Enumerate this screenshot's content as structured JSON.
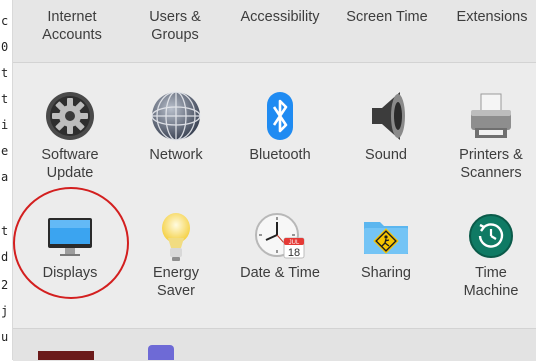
{
  "left_strip_chars": [
    "c",
    "0",
    "t",
    "t",
    "i",
    "e",
    "a",
    "t",
    "d",
    "2",
    "j",
    "u"
  ],
  "top_row": [
    {
      "label": "Internet\nAccounts"
    },
    {
      "label": "Users &\nGroups"
    },
    {
      "label": "Accessibility"
    },
    {
      "label": "Screen Time"
    },
    {
      "label": "Extensions"
    }
  ],
  "row2": [
    {
      "label": "Software\nUpdate",
      "icon": "gear-icon"
    },
    {
      "label": "Network",
      "icon": "globe-icon"
    },
    {
      "label": "Bluetooth",
      "icon": "bluetooth-icon"
    },
    {
      "label": "Sound",
      "icon": "speaker-icon"
    },
    {
      "label": "Printers &\nScanners",
      "icon": "printer-icon"
    }
  ],
  "row3": [
    {
      "label": "Displays",
      "icon": "display-icon"
    },
    {
      "label": "Energy\nSaver",
      "icon": "lightbulb-icon"
    },
    {
      "label": "Date & Time",
      "icon": "clock-calendar-icon",
      "calendar_month": "JUL",
      "calendar_day": "18"
    },
    {
      "label": "Sharing",
      "icon": "sharing-folder-icon"
    },
    {
      "label": "Time\nMachine",
      "icon": "time-machine-icon"
    }
  ],
  "colors": {
    "highlight_circle": "#d31f1f",
    "bluetooth_blue": "#1f8bf2",
    "display_blue": "#3ba4f0",
    "time_machine_green": "#0f7a64"
  }
}
